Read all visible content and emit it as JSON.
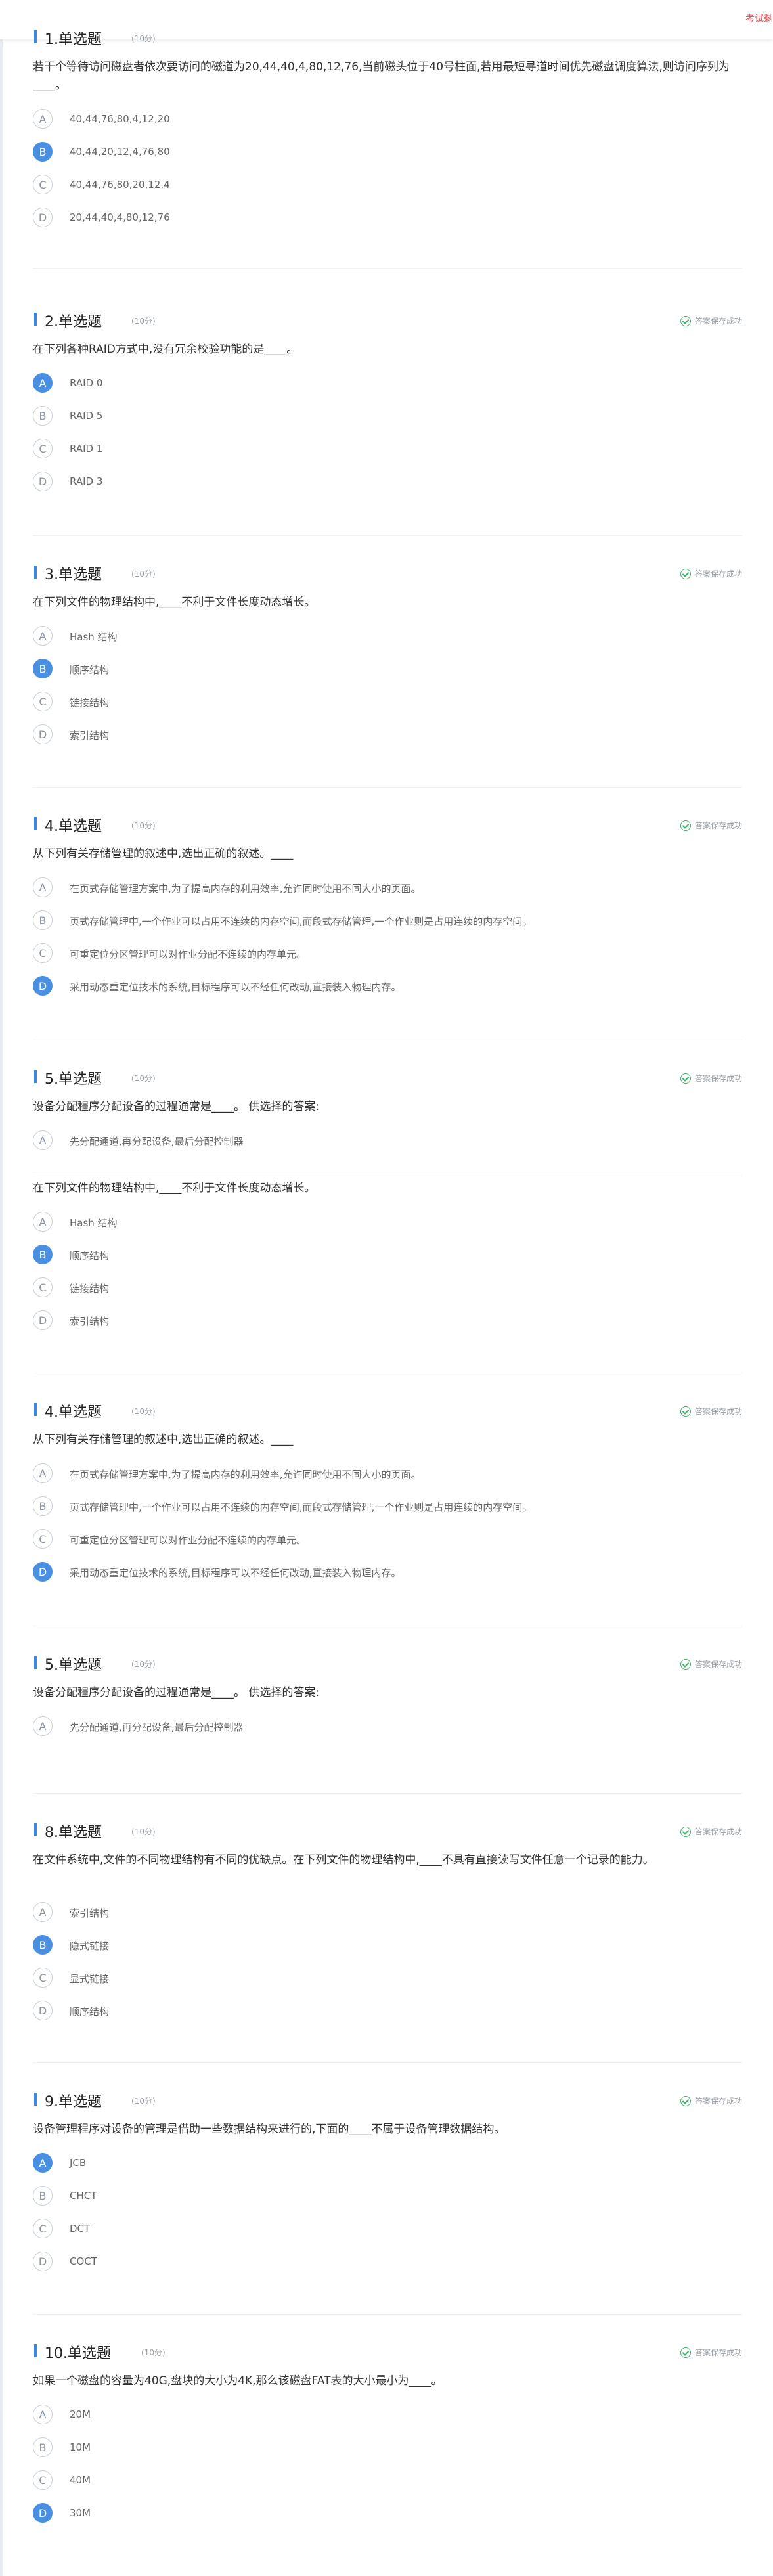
{
  "header": {
    "right_link": "考试剩"
  },
  "saved_text": "答案保存成功",
  "score_text": "(10分)",
  "questions": [
    {
      "title": "1.单选题",
      "stem": "若干个等待访问磁盘者依次要访问的磁道为20,44,40,4,80,12,76,当前磁头位于40号柱面,若用最短寻道时间优先磁盘调度算法,则访问序列为____。",
      "options": [
        {
          "letter": "A",
          "text": "40,44,76,80,4,12,20",
          "selected": false
        },
        {
          "letter": "B",
          "text": "40,44,20,12,4,76,80",
          "selected": true
        },
        {
          "letter": "C",
          "text": "40,44,76,80,20,12,4",
          "selected": false
        },
        {
          "letter": "D",
          "text": "20,44,40,4,80,12,76",
          "selected": false
        }
      ]
    },
    {
      "title": "2.单选题",
      "stem": "在下列各种RAID方式中,没有冗余校验功能的是____。",
      "options": [
        {
          "letter": "A",
          "text": "RAID 0",
          "selected": true
        },
        {
          "letter": "B",
          "text": "RAID 5",
          "selected": false
        },
        {
          "letter": "C",
          "text": "RAID 1",
          "selected": false
        },
        {
          "letter": "D",
          "text": "RAID 3",
          "selected": false
        }
      ]
    },
    {
      "title": "3.单选题",
      "stem": "在下列文件的物理结构中,____不利于文件长度动态增长。",
      "options": [
        {
          "letter": "A",
          "text": "Hash 结构",
          "selected": false
        },
        {
          "letter": "B",
          "text": "顺序结构",
          "selected": true
        },
        {
          "letter": "C",
          "text": "链接结构",
          "selected": false
        },
        {
          "letter": "D",
          "text": "索引结构",
          "selected": false
        }
      ]
    },
    {
      "title": "4.单选题",
      "stem": "从下列有关存储管理的叙述中,选出正确的叙述。____",
      "options": [
        {
          "letter": "A",
          "text": "在页式存储管理方案中,为了提高内存的利用效率,允许同时使用不同大小的页面。",
          "selected": false
        },
        {
          "letter": "B",
          "text": "页式存储管理中,一个作业可以占用不连续的内存空间,而段式存储管理,一个作业则是占用连续的内存空间。",
          "selected": false
        },
        {
          "letter": "C",
          "text": "可重定位分区管理可以对作业分配不连续的内存单元。",
          "selected": false
        },
        {
          "letter": "D",
          "text": "采用动态重定位技术的系统,目标程序可以不经任何改动,直接装入物理内存。",
          "selected": true
        }
      ]
    },
    {
      "title": "5.单选题",
      "stem": "设备分配程序分配设备的过程通常是____。 供选择的答案:",
      "options": [
        {
          "letter": "A",
          "text": "先分配通道,再分配设备,最后分配控制器",
          "selected": false
        }
      ]
    },
    {
      "title": "",
      "stem": "在下列文件的物理结构中,____不利于文件长度动态增长。",
      "options": [
        {
          "letter": "A",
          "text": "Hash 结构",
          "selected": false
        },
        {
          "letter": "B",
          "text": "顺序结构",
          "selected": true
        },
        {
          "letter": "C",
          "text": "链接结构",
          "selected": false
        },
        {
          "letter": "D",
          "text": "索引结构",
          "selected": false
        }
      ]
    },
    {
      "title": "4.单选题",
      "stem": "从下列有关存储管理的叙述中,选出正确的叙述。____",
      "options": [
        {
          "letter": "A",
          "text": "在页式存储管理方案中,为了提高内存的利用效率,允许同时使用不同大小的页面。",
          "selected": false
        },
        {
          "letter": "B",
          "text": "页式存储管理中,一个作业可以占用不连续的内存空间,而段式存储管理,一个作业则是占用连续的内存空间。",
          "selected": false
        },
        {
          "letter": "C",
          "text": "可重定位分区管理可以对作业分配不连续的内存单元。",
          "selected": false
        },
        {
          "letter": "D",
          "text": "采用动态重定位技术的系统,目标程序可以不经任何改动,直接装入物理内存。",
          "selected": true
        }
      ]
    },
    {
      "title": "5.单选题",
      "stem": "设备分配程序分配设备的过程通常是____。 供选择的答案:",
      "options": [
        {
          "letter": "A",
          "text": "先分配通道,再分配设备,最后分配控制器",
          "selected": false
        }
      ]
    },
    {
      "title": "8.单选题",
      "stem": "在文件系统中,文件的不同物理结构有不同的优缺点。在下列文件的物理结构中,____不具有直接读写文件任意一个记录的能力。",
      "options": [
        {
          "letter": "A",
          "text": "索引结构",
          "selected": false
        },
        {
          "letter": "B",
          "text": "隐式链接",
          "selected": true
        },
        {
          "letter": "C",
          "text": "显式链接",
          "selected": false
        },
        {
          "letter": "D",
          "text": "顺序结构",
          "selected": false
        }
      ]
    },
    {
      "title": "9.单选题",
      "stem": "设备管理程序对设备的管理是借助一些数据结构来进行的,下面的____不属于设备管理数据结构。",
      "options": [
        {
          "letter": "A",
          "text": "JCB",
          "selected": true
        },
        {
          "letter": "B",
          "text": "CHCT",
          "selected": false
        },
        {
          "letter": "C",
          "text": "DCT",
          "selected": false
        },
        {
          "letter": "D",
          "text": "COCT",
          "selected": false
        }
      ]
    },
    {
      "title": "10.单选题",
      "stem": "如果一个磁盘的容量为40G,盘块的大小为4K,那么该磁盘FAT表的大小最小为____。",
      "options": [
        {
          "letter": "A",
          "text": "20M",
          "selected": false
        },
        {
          "letter": "B",
          "text": "10M",
          "selected": false
        },
        {
          "letter": "C",
          "text": "40M",
          "selected": false
        },
        {
          "letter": "D",
          "text": "30M",
          "selected": true
        }
      ]
    }
  ]
}
